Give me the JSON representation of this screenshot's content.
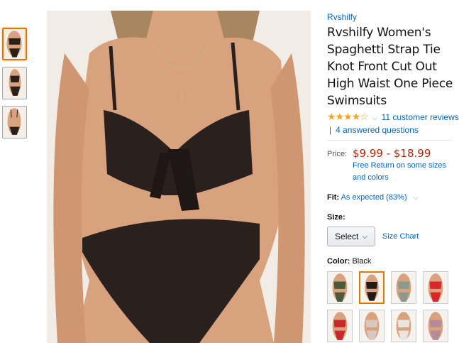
{
  "thumbnails": [
    {
      "name": "thumb-front",
      "suit_color": "#2b1f1c",
      "selected": true
    },
    {
      "name": "thumb-side",
      "suit_color": "#2b1f1c",
      "selected": false
    },
    {
      "name": "thumb-back",
      "suit_color": "#2b1f1c",
      "selected": false
    }
  ],
  "main_image": {
    "suit_color": "#2a201e",
    "skin_color": "#d9a27f"
  },
  "product": {
    "brand": "Rvshilfy",
    "title": "Rvshilfy Women's Spaghetti Strap Tie Knot Front Cut Out High Waist One Piece Swimsuits",
    "stars": "★★★★☆",
    "reviews": "11 customer reviews",
    "answered": "4 answered questions",
    "price_label": "Price:",
    "price": "$9.99 - $18.99",
    "free_return": "Free Return on some sizes and colors",
    "fit_label": "Fit:",
    "fit_value": "As expected (83%)",
    "size_label": "Size:",
    "size_select": "Select",
    "size_chart": "Size Chart",
    "color_label": "Color:",
    "color_value": "Black"
  },
  "swatches": [
    {
      "color": "#4b5a3a",
      "selected": false
    },
    {
      "color": "#231a19",
      "selected": true
    },
    {
      "color": "#8a9a8c",
      "selected": false
    },
    {
      "color": "#d8262b",
      "selected": false
    },
    {
      "color": "#c72a2a",
      "selected": false
    },
    {
      "color": "#d8c8c0",
      "selected": false
    },
    {
      "color": "#e9e6e2",
      "selected": false
    },
    {
      "color": "#b58b9a",
      "selected": false
    }
  ]
}
